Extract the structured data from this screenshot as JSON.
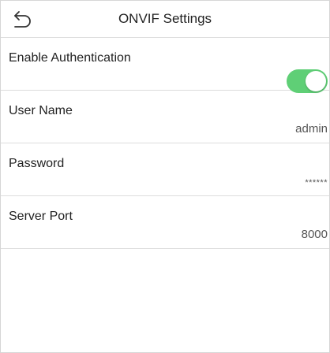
{
  "header": {
    "title": "ONVIF Settings",
    "back_icon": "back-arrow-icon"
  },
  "settings": {
    "enable_authentication": {
      "label": "Enable Authentication",
      "enabled": true,
      "toggle_color": "#5fcf76"
    },
    "user_name": {
      "label": "User Name",
      "value": "admin"
    },
    "password": {
      "label": "Password",
      "value": "******"
    },
    "server_port": {
      "label": "Server Port",
      "value": "8000"
    }
  }
}
